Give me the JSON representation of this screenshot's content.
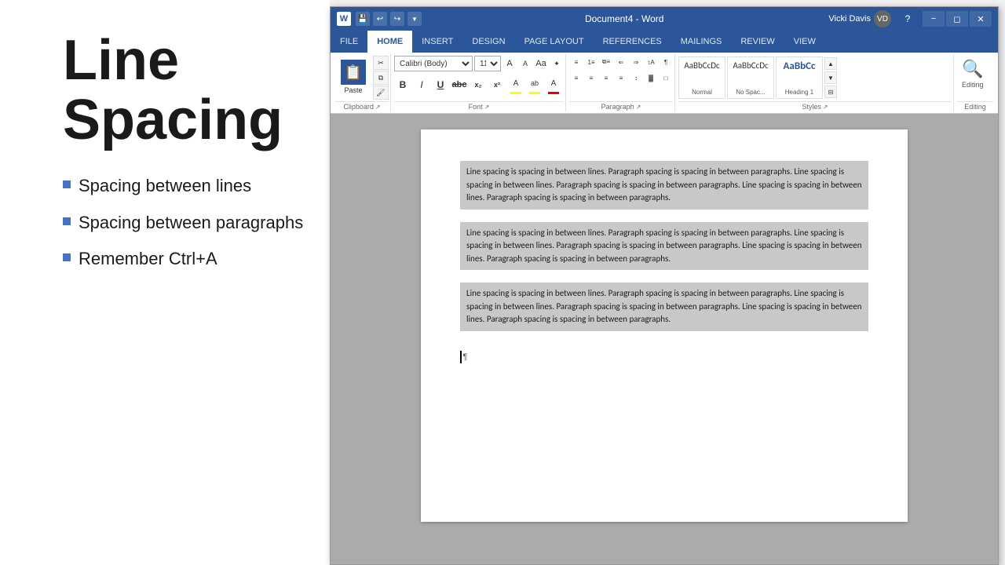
{
  "leftPanel": {
    "title": "Line\nSpacing",
    "bullets": [
      {
        "text": "Spacing between lines"
      },
      {
        "text": "Spacing between paragraphs"
      },
      {
        "text": "Remember Ctrl+A"
      }
    ]
  },
  "wordWindow": {
    "titleBar": {
      "title": "Document4 - Word",
      "appIcon": "W",
      "qatButtons": [
        "save",
        "undo",
        "redo",
        "customize"
      ],
      "controls": [
        "minimize",
        "restore",
        "close"
      ],
      "helpLabel": "?"
    },
    "ribbon": {
      "tabs": [
        "FILE",
        "HOME",
        "INSERT",
        "DESIGN",
        "PAGE LAYOUT",
        "REFERENCES",
        "MAILINGS",
        "REVIEW",
        "VIEW"
      ],
      "activeTab": "HOME",
      "groups": {
        "clipboard": {
          "label": "Clipboard",
          "pasteLabel": "Paste",
          "buttons": [
            "cut",
            "copy",
            "format-painter"
          ]
        },
        "font": {
          "label": "Font",
          "fontName": "Calibri (Body)",
          "fontSize": "11",
          "buttons": [
            "grow-font",
            "shrink-font",
            "clear-format",
            "bold",
            "italic",
            "underline",
            "strikethrough",
            "subscript",
            "superscript",
            "font-color",
            "highlight-color",
            "text-effects"
          ]
        },
        "paragraph": {
          "label": "Paragraph",
          "buttons": [
            "bullets",
            "numbering",
            "multilevel",
            "outdent",
            "indent",
            "sort",
            "show-marks",
            "align-left",
            "center",
            "align-right",
            "justify",
            "line-spacing",
            "shading",
            "borders"
          ]
        },
        "styles": {
          "label": "Styles",
          "items": [
            {
              "name": "Normal",
              "preview": "AaBbCcDc"
            },
            {
              "name": "No Spac...",
              "preview": "AaBbCcDc"
            },
            {
              "name": "Heading 1",
              "preview": "AaBbCc"
            }
          ]
        },
        "editing": {
          "label": "Editing",
          "icon": "🔍"
        }
      }
    },
    "document": {
      "paragraphs": [
        "Line spacing is spacing in between lines. Paragraph spacing is spacing in between paragraphs. Line spacing is spacing in between lines. Paragraph spacing is spacing in between paragraphs. Line spacing is spacing in between lines. Paragraph spacing is spacing in between paragraphs.",
        "Line spacing is spacing in between lines. Paragraph spacing is spacing in between paragraphs. Line spacing is spacing in between lines. Paragraph spacing is spacing in between paragraphs. Line spacing is spacing in between lines. Paragraph spacing is spacing in between paragraphs.",
        "Line spacing is spacing in between lines. Paragraph spacing is spacing in between paragraphs. Line spacing is spacing in between lines. Paragraph spacing is spacing in between paragraphs. Line spacing is spacing in between lines. Paragraph spacing is spacing in between paragraphs."
      ]
    },
    "user": {
      "name": "Vicki Davis"
    }
  }
}
